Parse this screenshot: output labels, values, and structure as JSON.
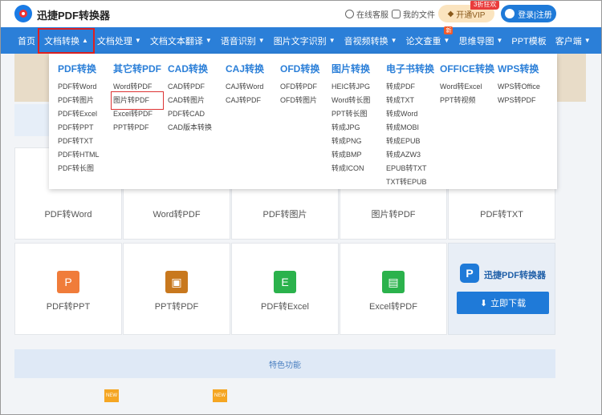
{
  "header": {
    "brand": "迅捷PDF转换器",
    "service": "在线客服",
    "my_files": "我的文件",
    "vip_label": "开通VIP",
    "vip_badge": "3折狂欢",
    "login": "登录|注册"
  },
  "nav": [
    {
      "label": "首页",
      "caret": false
    },
    {
      "label": "文档转换",
      "caret": true,
      "active": true
    },
    {
      "label": "文档处理",
      "caret": true
    },
    {
      "label": "文档文本翻译",
      "caret": true
    },
    {
      "label": "语音识别",
      "caret": true
    },
    {
      "label": "图片文字识别",
      "caret": true
    },
    {
      "label": "音视频转换",
      "caret": true
    },
    {
      "label": "论文查重",
      "caret": true,
      "tag": "新"
    },
    {
      "label": "思维导图",
      "caret": true
    },
    {
      "label": "PPT模板",
      "caret": false
    },
    {
      "label": "客户端",
      "caret": true
    }
  ],
  "dropdown": [
    {
      "title": "PDF转换",
      "items": [
        "PDF转Word",
        "PDF转图片",
        "PDF转Excel",
        "PDF转PPT",
        "PDF转TXT",
        "PDF转HTML",
        "PDF转长图"
      ]
    },
    {
      "title": "其它转PDF",
      "items": [
        "Word转PDF",
        "图片转PDF",
        "Excel转PDF",
        "PPT转PDF"
      ],
      "highlight": 1
    },
    {
      "title": "CAD转换",
      "items": [
        "CAD转PDF",
        "CAD转图片",
        "PDF转CAD",
        "CAD版本转换"
      ]
    },
    {
      "title": "CAJ转换",
      "items": [
        "CAJ转Word",
        "CAJ转PDF"
      ]
    },
    {
      "title": "OFD转换",
      "items": [
        "OFD转PDF",
        "OFD转图片"
      ]
    },
    {
      "title": "图片转换",
      "items": [
        "HEIC转JPG",
        "Word转长图",
        "PPT转长图",
        "转成JPG",
        "转成PNG",
        "转成BMP",
        "转成ICON"
      ]
    },
    {
      "title": "电子书转换",
      "items": [
        "转成PDF",
        "转成TXT",
        "转成Word",
        "转成MOBI",
        "转成EPUB",
        "转成AZW3",
        "EPUB转TXT",
        "TXT转EPUB"
      ]
    },
    {
      "title": "OFFICE转换",
      "items": [
        "Word转Excel",
        "PPT转视频"
      ]
    },
    {
      "title": "WPS转换",
      "items": [
        "WPS转Office",
        "WPS转PDF"
      ]
    }
  ],
  "tiles_row1": [
    "PDF转Word",
    "Word转PDF",
    "PDF转图片",
    "图片转PDF",
    "PDF转TXT"
  ],
  "tiles_row2": [
    {
      "label": "PDF转PPT",
      "glyph": "P",
      "color": "#f07c3a"
    },
    {
      "label": "PPT转PDF",
      "glyph": "▣",
      "color": "#c8781e"
    },
    {
      "label": "PDF转Excel",
      "glyph": "E",
      "color": "#2bb24c"
    },
    {
      "label": "Excel转PDF",
      "glyph": "▤",
      "color": "#2bb24c"
    }
  ],
  "promo": {
    "logo": "P",
    "name": "迅捷PDF转换器",
    "button": "立即下载"
  },
  "features": "特色功能",
  "new_label": "NEW"
}
